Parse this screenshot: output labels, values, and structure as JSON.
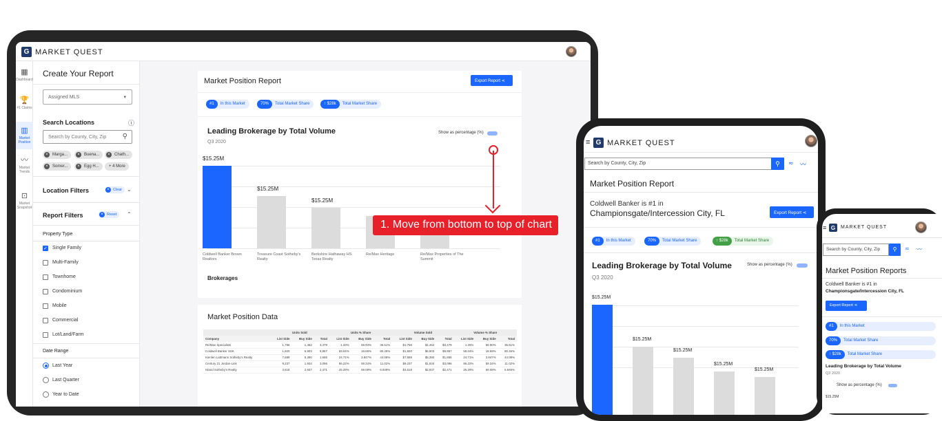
{
  "brand": "MARKET QUEST",
  "logo_glyph": "G",
  "rail": {
    "items": [
      {
        "label": "Dashboard",
        "icon": "dashboard-icon"
      },
      {
        "label": "#1 Claims",
        "icon": "trophy-icon"
      },
      {
        "label": "Market Position",
        "icon": "bar-chart-icon",
        "active": true
      },
      {
        "label": "Market Trends",
        "icon": "trend-icon"
      },
      {
        "label": "Market Snapshot",
        "icon": "snapshot-icon"
      }
    ]
  },
  "panel": {
    "title": "Create Your Report",
    "mls_placeholder": "Assigned MLS",
    "search_title": "Search Locations",
    "search_placeholder": "Search by County, City, Zip",
    "chips": [
      "Marga...",
      "Buena...",
      "Chath...",
      "Somer...",
      "Egg H...",
      "+ 4 More"
    ],
    "location_filters": "Location Filters",
    "clear": "Clear",
    "report_filters": "Report Filters",
    "reset": "Reset",
    "property_type": "Property Type",
    "property_options": [
      {
        "label": "Single Family",
        "checked": true
      },
      {
        "label": "Multi-Family",
        "checked": false
      },
      {
        "label": "Townhome",
        "checked": false
      },
      {
        "label": "Condominium",
        "checked": false
      },
      {
        "label": "Mobile",
        "checked": false
      },
      {
        "label": "Commercial",
        "checked": false
      },
      {
        "label": "Lot/Land/Farm",
        "checked": false
      }
    ],
    "date_range": "Date Range",
    "date_options": [
      {
        "label": "Last Year",
        "checked": true
      },
      {
        "label": "Last Quarter",
        "checked": false
      },
      {
        "label": "Year to Date",
        "checked": false
      }
    ]
  },
  "report": {
    "title": "Market Position Report",
    "export_label": "Export Report",
    "badges": [
      {
        "badge": "#1",
        "text": "In this Market"
      },
      {
        "badge": "70%",
        "text": "Total Market Share"
      },
      {
        "badge": "↑ $28k",
        "text": "Total Market Share"
      }
    ],
    "chart_title": "Leading Brokerage by Total Volume",
    "period": "Q3 2020",
    "toggle_label": "Show as percentage (%)",
    "x_axis_title": "Brokerages"
  },
  "chart_data": {
    "type": "bar",
    "title": "Leading Brokerage by Total Volume",
    "subtitle": "Q3 2020",
    "xlabel": "Brokerages",
    "ylabel": "",
    "categories": [
      "Coldwell Banker Brown Realtors",
      "Treasure Coast Sotheby's Realty",
      "Berkshire Hathaway HS Texas Realty",
      "Re/Max Heritage",
      "Re/Max Properties of The Summit"
    ],
    "values": [
      15.25,
      9.6,
      7.5,
      6.0,
      5.2
    ],
    "value_labels": [
      "$15.25M",
      "$15.25M",
      "$15.25M",
      "$15.25M",
      "$15.25M"
    ],
    "ylim": [
      0,
      15.25
    ],
    "colors": {
      "highlight": "#1a66ff",
      "other": "#dcdcdc"
    }
  },
  "data_section": {
    "title": "Market Position Data",
    "groups": [
      "Units Sold",
      "Units % Share",
      "Volume Sold",
      "Volume % Share"
    ],
    "columns": [
      "Company",
      "List Side",
      "Buy Side",
      "Total",
      "List Side",
      "Buy Side",
      "Total",
      "List Side",
      "Buy Side",
      "Total",
      "List Side",
      "Buy Side",
      "Total"
    ],
    "rows": [
      [
        "Re/Max Specialists",
        "1,756",
        "1,462",
        "3,479",
        "1.33%",
        "59.93%",
        "36.51%",
        "$1,756",
        "$1,462",
        "$3,479",
        "1.25%",
        "59.90%",
        "36.51%"
      ],
      [
        "Coldwell Banker SSK",
        "1,820",
        "6,903",
        "9,957",
        "59.04%",
        "18.69%",
        "80.45%",
        "$1,820",
        "$6,903",
        "$9,957",
        "59.04%",
        "18.69%",
        "80.45%"
      ],
      [
        "Kienlen Lattmann Sotheby's Realty",
        "7,689",
        "5,390",
        "1,655",
        "24.71%",
        "3.847%",
        "44.08%",
        "$7,689",
        "$5,390",
        "$1,655",
        "24.71%",
        "3.847%",
        "44.08%"
      ],
      [
        "Century 21 Jordan-Link",
        "9,237",
        "1,934",
        "3,096",
        "86.22%",
        "59.34%",
        "11.02%",
        "$9,237",
        "$1,934",
        "$3,096",
        "86.22%",
        "59.34%",
        "11.02%"
      ],
      [
        "Island Sotheby's Realty",
        "3,618",
        "2,937",
        "2,471",
        "25.29%",
        "69.08%",
        "6.949%",
        "$3,618",
        "$2,937",
        "$2,471",
        "25.29%",
        "69.08%",
        "6.945%"
      ]
    ]
  },
  "annotation": {
    "text": "1. Move from bottom to top of chart",
    "color": "#e8202a"
  },
  "tablet": {
    "search_placeholder": "Search by County, City, Zip",
    "title": "Market Position Report",
    "rank_line": "Coldwell Banker is #1 in",
    "location": "Championsgate/Intercession City, FL",
    "export_label": "Export Report",
    "badges": [
      {
        "badge": "#1",
        "text": "In this Market"
      },
      {
        "badge": "70%",
        "text": "Total Market Share"
      },
      {
        "badge": "↑ $28k",
        "text": "Total Market Share"
      }
    ],
    "chart_title": "Leading Brokerage by Total Volume",
    "period": "Q3 2020",
    "toggle_label": "Show as percentage (%)",
    "value_labels": [
      "$15.25M",
      "$15.25M",
      "$15.25M",
      "$15.25M",
      "$15.25M"
    ],
    "x_labels": [
      "Treasure Coast",
      "Coldwell Banker",
      "Berkshire Hathaway",
      "Re/Max Heritage",
      "Re/Max Properties of"
    ]
  },
  "phone": {
    "search_placeholder": "Search by County, City, Zip",
    "title": "Market Position Reports",
    "rank_line": "Coldwell Banker is #1 in",
    "location": "Championsgate/Intercession City, FL",
    "export_label": "Export Report",
    "badges": [
      {
        "badge": "#1",
        "text": "In this Market"
      },
      {
        "badge": "70%",
        "text": "Total Market Share"
      },
      {
        "badge": "↑ $28k",
        "text": "Total Market Share"
      }
    ],
    "chart_title": "Leading Brokerage by Total Volume",
    "period": "Q3 2020",
    "toggle_label": "Show as percentage (%)",
    "first_value": "$15.25M"
  }
}
